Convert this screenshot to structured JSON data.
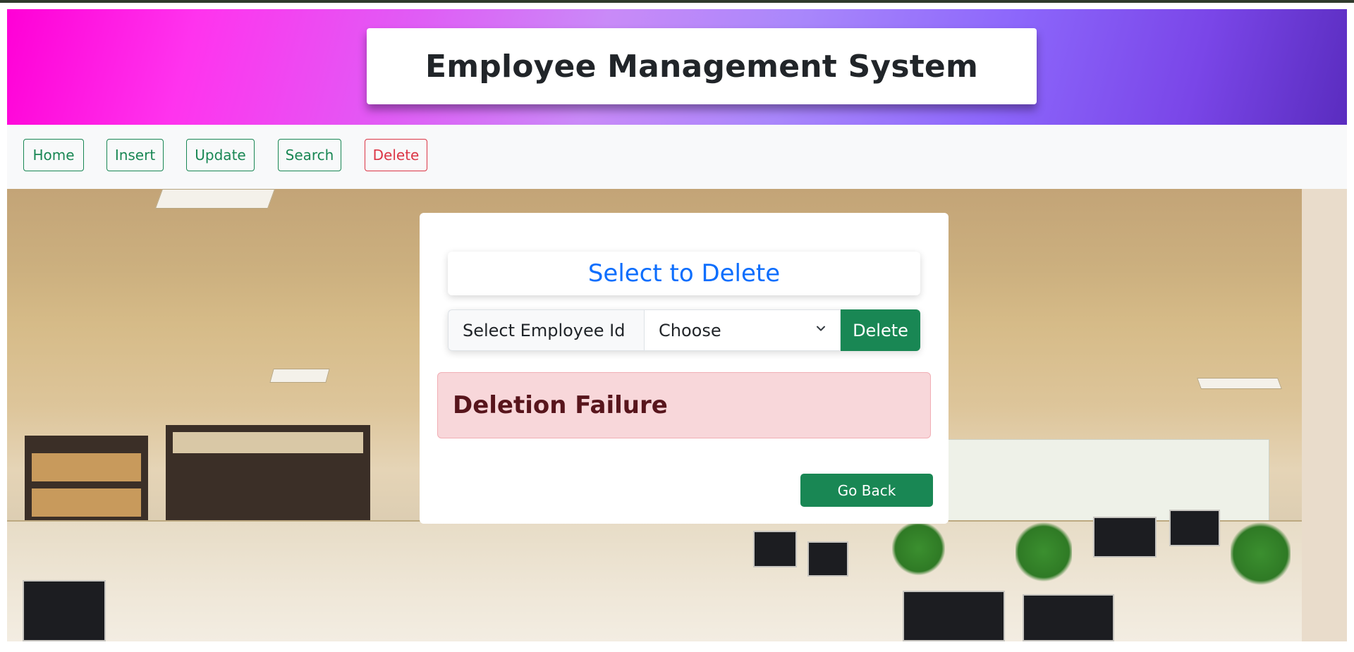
{
  "header": {
    "title": "Employee Management System"
  },
  "nav": {
    "items": [
      {
        "label": "Home"
      },
      {
        "label": "Insert"
      },
      {
        "label": "Update"
      },
      {
        "label": "Search"
      },
      {
        "label": "Delete"
      }
    ]
  },
  "card": {
    "heading": "Select to Delete",
    "select_label": "Select Employee Id",
    "select_value": "Choose",
    "delete_button": "Delete",
    "alert_message": "Deletion Failure",
    "go_back_button": "Go Back"
  },
  "colors": {
    "success": "#198754",
    "danger": "#dc3545",
    "primary": "#0d6efd",
    "alert_bg": "#f8d7da",
    "alert_text": "#58151c"
  },
  "icons": {
    "select_arrow": "chevron-down-icon"
  }
}
